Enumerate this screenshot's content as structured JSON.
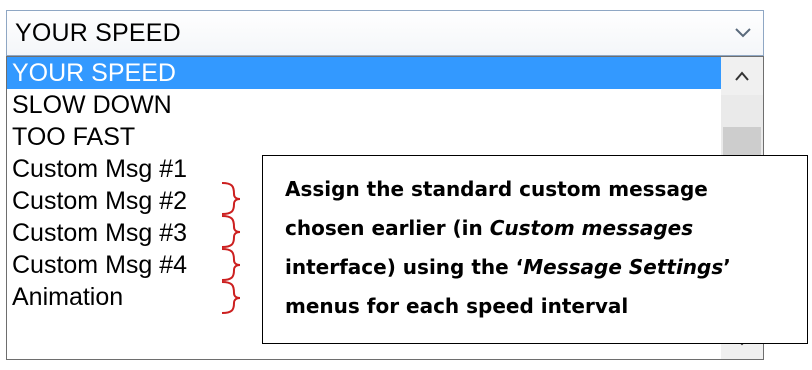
{
  "select": {
    "value": "YOUR SPEED",
    "arrow_icon": "chevron-down-icon"
  },
  "dropdown": {
    "options": [
      {
        "label": "YOUR SPEED",
        "selected": true
      },
      {
        "label": "SLOW DOWN",
        "selected": false
      },
      {
        "label": "TOO FAST",
        "selected": false
      },
      {
        "label": "Custom Msg #1",
        "selected": false
      },
      {
        "label": "Custom Msg #2",
        "selected": false
      },
      {
        "label": "Custom Msg #3",
        "selected": false
      },
      {
        "label": "Custom Msg #4",
        "selected": false
      },
      {
        "label": "Animation",
        "selected": false
      }
    ],
    "scroll_up_icon": "chevron-up-icon",
    "scroll_down_icon": "chevron-down-icon"
  },
  "annotation": {
    "bracket_icon": "red-brace-icon",
    "bracket_color": "#cc1f1f",
    "callout": {
      "line1": "Assign the standard custom message",
      "line2_prefix": "chosen earlier (in ",
      "line2_em": "Custom messages",
      "line3": "interface) using the ‘",
      "line3_em": "Message Settings",
      "line3_suffix": "’",
      "line4": "menus for each speed interval"
    }
  },
  "colors": {
    "selection": "#3399ff",
    "select_border": "#8fa7c4"
  }
}
